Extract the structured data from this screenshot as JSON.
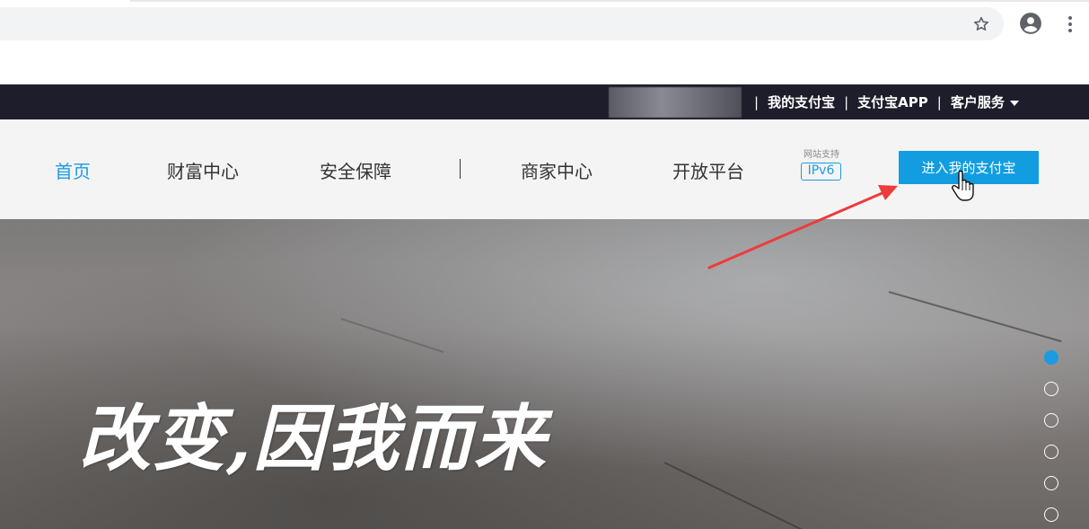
{
  "topbar": {
    "links": [
      {
        "label": "我的支付宝"
      },
      {
        "label": "支付宝APP"
      },
      {
        "label": "客户服务"
      }
    ],
    "separator": "|"
  },
  "nav": {
    "items": [
      {
        "label": "首页",
        "active": true
      },
      {
        "label": "财富中心",
        "active": false
      },
      {
        "label": "安全保障",
        "active": false
      },
      {
        "label": "商家中心",
        "active": false
      },
      {
        "label": "开放平台",
        "active": false
      }
    ],
    "ipv6_support": "网站支持",
    "ipv6_label": "IPv6",
    "cta_label": "进入我的支付宝"
  },
  "hero": {
    "slogan": "改变,因我而来",
    "carousel": {
      "count": 6,
      "active_index": 0
    }
  },
  "colors": {
    "accent": "#1a9ce0",
    "cta": "#119ddf",
    "topbar": "#1d1d2b",
    "annotation_arrow": "#ee3b3b"
  }
}
